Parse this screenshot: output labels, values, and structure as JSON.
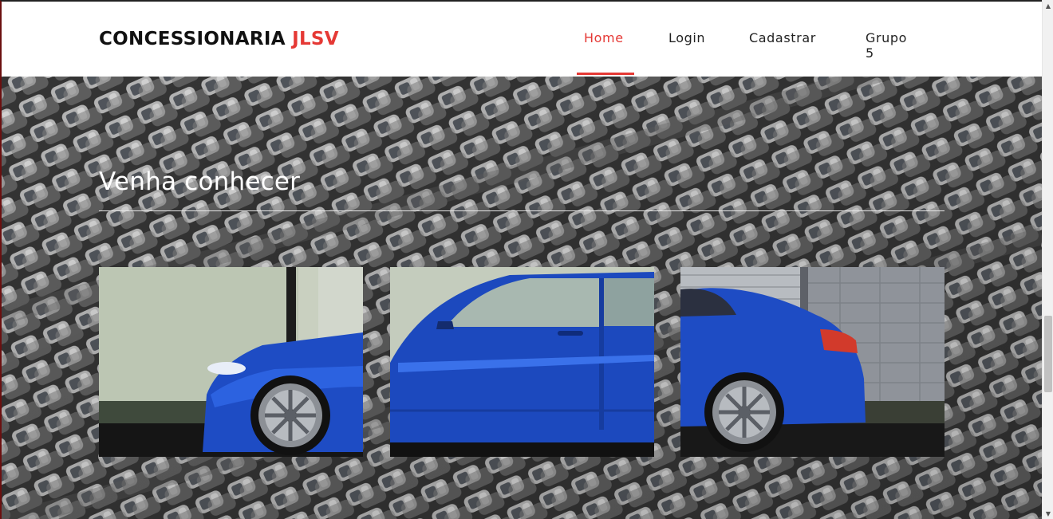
{
  "brand": {
    "name": "CONCESSIONARIA",
    "accent": "JLSV",
    "accent_color": "#e53935"
  },
  "nav": {
    "items": [
      {
        "label": "Home",
        "active": true
      },
      {
        "label": "Login",
        "active": false
      },
      {
        "label": "Cadastrar",
        "active": false
      },
      {
        "label": "Grupo 5",
        "active": false
      }
    ]
  },
  "hero": {
    "title": "Venha conhecer",
    "background": "parking-lot-photo",
    "gallery": [
      {
        "name": "car-front-photo"
      },
      {
        "name": "car-middle-photo"
      },
      {
        "name": "car-rear-photo"
      }
    ]
  },
  "colors": {
    "accent": "#e53935",
    "car_blue": "#1f4fc9",
    "text": "#222222"
  }
}
